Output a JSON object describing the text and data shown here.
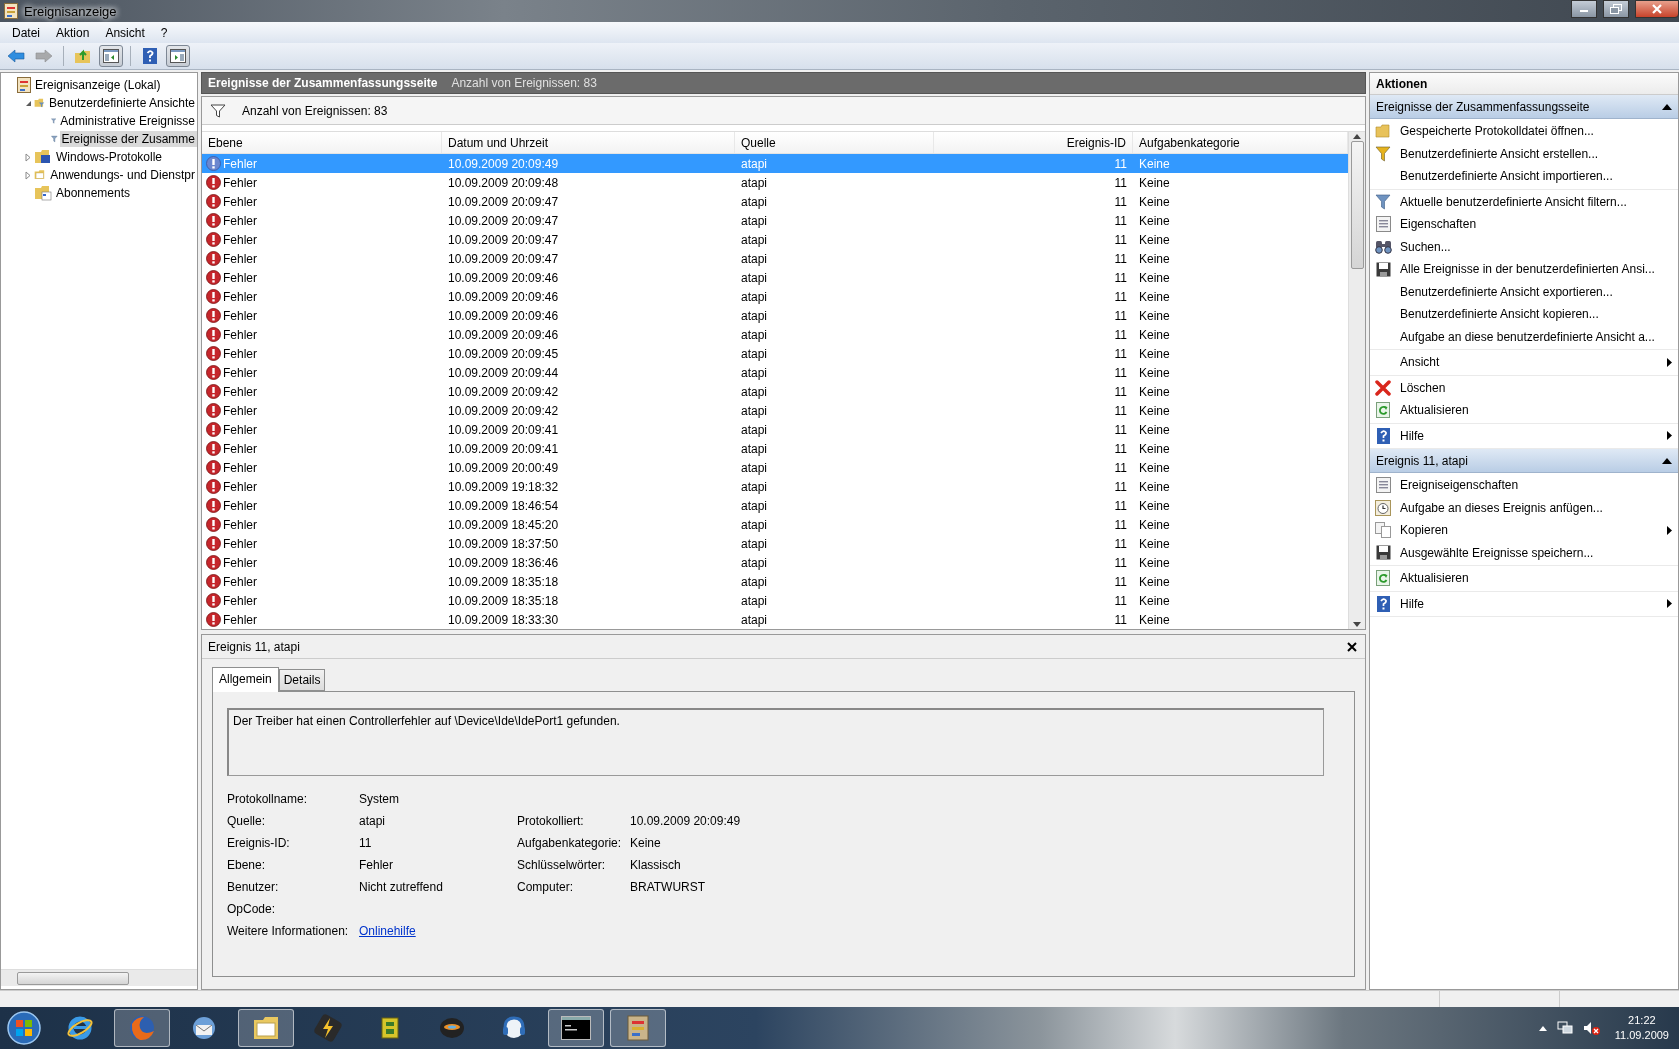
{
  "window": {
    "title": "Ereignisanzeige"
  },
  "menu": [
    {
      "label": "Datei"
    },
    {
      "label": "Aktion"
    },
    {
      "label": "Ansicht"
    },
    {
      "label": "?"
    }
  ],
  "toolbar": [
    {
      "kind": "back",
      "disabled": false,
      "pressed": false
    },
    {
      "kind": "forward",
      "disabled": true,
      "pressed": false
    },
    {
      "kind": "up",
      "disabled": false,
      "pressed": false
    },
    {
      "kind": "tree-toggle",
      "disabled": false,
      "pressed": true
    },
    {
      "kind": "help",
      "disabled": false,
      "pressed": false
    },
    {
      "kind": "pane-toggle",
      "disabled": false,
      "pressed": true
    }
  ],
  "tree": [
    {
      "label": "Ereignisanzeige (Lokal)",
      "kind": "computer",
      "selected": false,
      "children": [
        {
          "label": "Benutzerdefinierte Ansichte",
          "kind": "folder-filter",
          "expanded": true,
          "selected": false,
          "children": [
            {
              "label": "Administrative Ereignisse",
              "kind": "filter",
              "selected": false
            },
            {
              "label": "Ereignisse der Zusamme",
              "kind": "filter",
              "selected": true
            }
          ]
        },
        {
          "label": "Windows-Protokolle",
          "kind": "folder-log",
          "expanded": false,
          "selected": false
        },
        {
          "label": "Anwendungs- und Dienstpr",
          "kind": "folder",
          "expanded": false,
          "selected": false
        },
        {
          "label": "Abonnements",
          "kind": "subscriptions",
          "selected": false
        }
      ]
    }
  ],
  "center": {
    "title": "Ereignisse der Zusammenfassungsseite",
    "count": "Anzahl von Ereignissen: 83",
    "filter_text": "Anzahl von Ereignissen: 83",
    "columns": [
      "Ebene",
      "Datum und Uhrzeit",
      "Quelle",
      "Ereignis-ID",
      "Aufgabenkategorie"
    ],
    "rows": [
      {
        "level": "Fehler",
        "date": "10.09.2009 20:09:49",
        "source": "atapi",
        "id": "11",
        "category": "Keine",
        "selected": true
      },
      {
        "level": "Fehler",
        "date": "10.09.2009 20:09:48",
        "source": "atapi",
        "id": "11",
        "category": "Keine",
        "selected": false
      },
      {
        "level": "Fehler",
        "date": "10.09.2009 20:09:47",
        "source": "atapi",
        "id": "11",
        "category": "Keine",
        "selected": false
      },
      {
        "level": "Fehler",
        "date": "10.09.2009 20:09:47",
        "source": "atapi",
        "id": "11",
        "category": "Keine",
        "selected": false
      },
      {
        "level": "Fehler",
        "date": "10.09.2009 20:09:47",
        "source": "atapi",
        "id": "11",
        "category": "Keine",
        "selected": false
      },
      {
        "level": "Fehler",
        "date": "10.09.2009 20:09:47",
        "source": "atapi",
        "id": "11",
        "category": "Keine",
        "selected": false
      },
      {
        "level": "Fehler",
        "date": "10.09.2009 20:09:46",
        "source": "atapi",
        "id": "11",
        "category": "Keine",
        "selected": false
      },
      {
        "level": "Fehler",
        "date": "10.09.2009 20:09:46",
        "source": "atapi",
        "id": "11",
        "category": "Keine",
        "selected": false
      },
      {
        "level": "Fehler",
        "date": "10.09.2009 20:09:46",
        "source": "atapi",
        "id": "11",
        "category": "Keine",
        "selected": false
      },
      {
        "level": "Fehler",
        "date": "10.09.2009 20:09:46",
        "source": "atapi",
        "id": "11",
        "category": "Keine",
        "selected": false
      },
      {
        "level": "Fehler",
        "date": "10.09.2009 20:09:45",
        "source": "atapi",
        "id": "11",
        "category": "Keine",
        "selected": false
      },
      {
        "level": "Fehler",
        "date": "10.09.2009 20:09:44",
        "source": "atapi",
        "id": "11",
        "category": "Keine",
        "selected": false
      },
      {
        "level": "Fehler",
        "date": "10.09.2009 20:09:42",
        "source": "atapi",
        "id": "11",
        "category": "Keine",
        "selected": false
      },
      {
        "level": "Fehler",
        "date": "10.09.2009 20:09:42",
        "source": "atapi",
        "id": "11",
        "category": "Keine",
        "selected": false
      },
      {
        "level": "Fehler",
        "date": "10.09.2009 20:09:41",
        "source": "atapi",
        "id": "11",
        "category": "Keine",
        "selected": false
      },
      {
        "level": "Fehler",
        "date": "10.09.2009 20:09:41",
        "source": "atapi",
        "id": "11",
        "category": "Keine",
        "selected": false
      },
      {
        "level": "Fehler",
        "date": "10.09.2009 20:00:49",
        "source": "atapi",
        "id": "11",
        "category": "Keine",
        "selected": false
      },
      {
        "level": "Fehler",
        "date": "10.09.2009 19:18:32",
        "source": "atapi",
        "id": "11",
        "category": "Keine",
        "selected": false
      },
      {
        "level": "Fehler",
        "date": "10.09.2009 18:46:54",
        "source": "atapi",
        "id": "11",
        "category": "Keine",
        "selected": false
      },
      {
        "level": "Fehler",
        "date": "10.09.2009 18:45:20",
        "source": "atapi",
        "id": "11",
        "category": "Keine",
        "selected": false
      },
      {
        "level": "Fehler",
        "date": "10.09.2009 18:37:50",
        "source": "atapi",
        "id": "11",
        "category": "Keine",
        "selected": false
      },
      {
        "level": "Fehler",
        "date": "10.09.2009 18:36:46",
        "source": "atapi",
        "id": "11",
        "category": "Keine",
        "selected": false
      },
      {
        "level": "Fehler",
        "date": "10.09.2009 18:35:18",
        "source": "atapi",
        "id": "11",
        "category": "Keine",
        "selected": false
      },
      {
        "level": "Fehler",
        "date": "10.09.2009 18:35:18",
        "source": "atapi",
        "id": "11",
        "category": "Keine",
        "selected": false
      },
      {
        "level": "Fehler",
        "date": "10.09.2009 18:33:30",
        "source": "atapi",
        "id": "11",
        "category": "Keine",
        "selected": false
      }
    ]
  },
  "detail": {
    "title": "Ereignis 11, atapi",
    "tabs": [
      {
        "label": "Allgemein",
        "selected": true
      },
      {
        "label": "Details",
        "selected": false
      }
    ],
    "message": "Der Treiber hat einen Controllerfehler auf \\Device\\Ide\\IdePort1 gefunden.",
    "fields": [
      {
        "left": {
          "label": "Protokollname:",
          "value": "System"
        }
      },
      {
        "left": {
          "label": "Quelle:",
          "value": "atapi"
        },
        "right": {
          "label": "Protokolliert:",
          "value": "10.09.2009 20:09:49"
        }
      },
      {
        "left": {
          "label": "Ereignis-ID:",
          "value": "11"
        },
        "right": {
          "label": "Aufgabenkategorie:",
          "value": "Keine"
        }
      },
      {
        "left": {
          "label": "Ebene:",
          "value": "Fehler"
        },
        "right": {
          "label": "Schlüsselwörter:",
          "value": "Klassisch"
        }
      },
      {
        "left": {
          "label": "Benutzer:",
          "value": "Nicht zutreffend"
        },
        "right": {
          "label": "Computer:",
          "value": "BRATWURST"
        }
      },
      {
        "left": {
          "label": "OpCode:"
        }
      },
      {
        "left": {
          "label": "Weitere Informationen:",
          "link": "Onlinehilfe"
        }
      }
    ]
  },
  "actions": {
    "title": "Aktionen",
    "sections": [
      {
        "title": "Ereignisse der Zusammenfassungsseite",
        "expanded": true,
        "groups": [
          [
            {
              "label": "Gespeicherte Protokolldatei öffnen...",
              "kind": "folder",
              "submenu": false
            },
            {
              "label": "Benutzerdefinierte Ansicht erstellen...",
              "kind": "funnel-new",
              "submenu": false
            },
            {
              "label": "Benutzerdefinierte Ansicht importieren...",
              "kind": "none",
              "submenu": false
            }
          ],
          [
            {
              "label": "Aktuelle benutzerdefinierte Ansicht filtern...",
              "kind": "funnel",
              "submenu": false
            },
            {
              "label": "Eigenschaften",
              "kind": "properties",
              "submenu": false
            },
            {
              "label": "Suchen...",
              "kind": "binoculars",
              "submenu": false
            },
            {
              "label": "Alle Ereignisse in der benutzerdefinierten Ansi...",
              "kind": "save",
              "submenu": false
            },
            {
              "label": "Benutzerdefinierte Ansicht exportieren...",
              "kind": "none",
              "submenu": false
            },
            {
              "label": "Benutzerdefinierte Ansicht kopieren...",
              "kind": "none",
              "submenu": false
            },
            {
              "label": "Aufgabe an diese benutzerdefinierte Ansicht a...",
              "kind": "none",
              "submenu": false
            }
          ],
          [
            {
              "label": "Ansicht",
              "kind": "none",
              "submenu": true
            }
          ],
          [
            {
              "label": "Löschen",
              "kind": "delete",
              "submenu": false
            },
            {
              "label": "Aktualisieren",
              "kind": "refresh",
              "submenu": false
            }
          ],
          [
            {
              "label": "Hilfe",
              "kind": "help",
              "submenu": true
            }
          ]
        ]
      },
      {
        "title": "Ereignis 11, atapi",
        "expanded": true,
        "groups": [
          [
            {
              "label": "Ereigniseigenschaften",
              "kind": "properties",
              "submenu": false
            },
            {
              "label": "Aufgabe an dieses Ereignis anfügen...",
              "kind": "task",
              "submenu": false
            },
            {
              "label": "Kopieren",
              "kind": "copy",
              "submenu": true
            },
            {
              "label": "Ausgewählte Ereignisse speichern...",
              "kind": "save",
              "submenu": false
            }
          ],
          [
            {
              "label": "Aktualisieren",
              "kind": "refresh",
              "submenu": false
            }
          ],
          [
            {
              "label": "Hilfe",
              "kind": "help",
              "submenu": true
            }
          ]
        ]
      }
    ]
  },
  "taskbar": {
    "buttons": [
      {
        "kind": "browser-e",
        "active": false
      },
      {
        "kind": "fox",
        "active": true
      },
      {
        "kind": "mail",
        "active": false
      },
      {
        "kind": "explorer",
        "active": true
      },
      {
        "kind": "bolt",
        "active": false
      },
      {
        "kind": "puzzle",
        "active": false
      },
      {
        "kind": "disc",
        "active": false
      },
      {
        "kind": "headset",
        "active": false
      },
      {
        "kind": "console",
        "active": true
      },
      {
        "kind": "event-viewer",
        "active": true
      }
    ],
    "clock": {
      "time": "21:22",
      "date": "11.09.2009"
    }
  }
}
